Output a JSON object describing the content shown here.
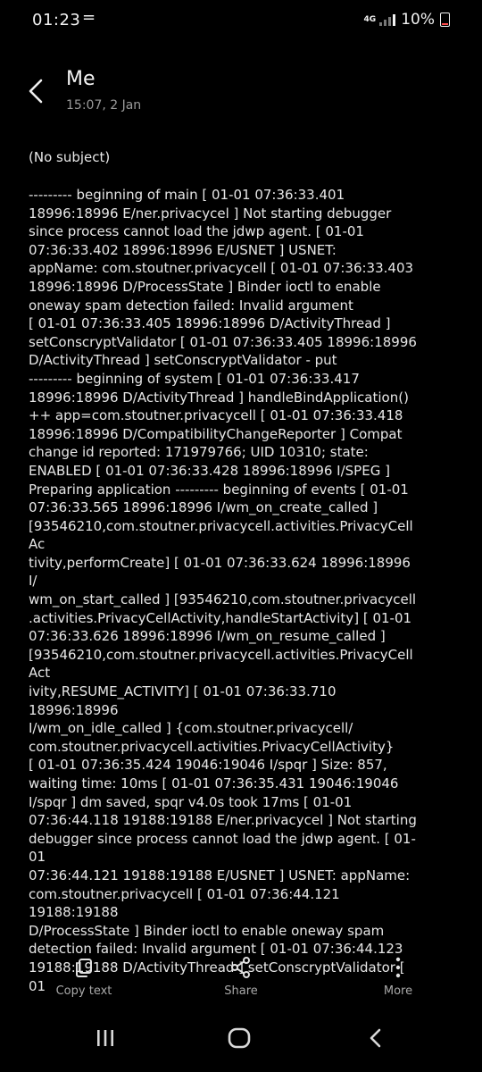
{
  "status_bar": {
    "time": "01:23",
    "menu_glyph": "=",
    "network": "4G",
    "battery": "10%",
    "battery_color": "#ff4a4a"
  },
  "header": {
    "back_icon": "chevron-left-icon",
    "sender": "Me",
    "sent_time": "15:07, 2 Jan"
  },
  "message": {
    "subject": "(No subject)",
    "body": "--------- beginning of main [ 01-01 07:36:33.401\n18996:18996 E/ner.privacycel ] Not starting debugger\nsince process cannot load the jdwp agent.  [ 01-01\n07:36:33.402 18996:18996 E/USNET    ] USNET:\nappName: com.stoutner.privacycell  [ 01-01 07:36:33.403\n18996:18996 D/ProcessState ] Binder ioctl to enable\noneway spam detection failed: Invalid argument\n[ 01-01 07:36:33.405 18996:18996 D/ActivityThread ]\nsetConscryptValidator  [ 01-01 07:36:33.405 18996:18996\nD/ActivityThread ] setConscryptValidator - put\n--------- beginning of system [ 01-01 07:36:33.417\n18996:18996 D/ActivityThread ] handleBindApplication()\n++ app=com.stoutner.privacycell  [ 01-01 07:36:33.418\n18996:18996 D/CompatibilityChangeReporter ] Compat\nchange id reported: 171979766; UID 10310; state:\nENABLED  [ 01-01 07:36:33.428 18996:18996 I/SPEG    ]\nPreparing application  --------- beginning of events [ 01-01\n07:36:33.565 18996:18996 I/wm_on_create_called ]\n[93546210,com.stoutner.privacycell.activities.PrivacyCellAc\ntivity,performCreate]  [ 01-01 07:36:33.624 18996:18996 I/\nwm_on_start_called ] [93546210,com.stoutner.privacycell\n.activities.PrivacyCellActivity,handleStartActivity]  [ 01-01\n07:36:33.626 18996:18996 I/wm_on_resume_called ]\n[93546210,com.stoutner.privacycell.activities.PrivacyCellAct\nivity,RESUME_ACTIVITY]  [ 01-01 07:36:33.710 18996:18996\nI/wm_on_idle_called ] {com.stoutner.privacycell/\ncom.stoutner.privacycell.activities.PrivacyCellActivity}\n[ 01-01 07:36:35.424 19046:19046 I/spqr     ] Size: 857,\nwaiting time: 10ms  [ 01-01 07:36:35.431 19046:19046\nI/spqr     ] dm saved, spqr v4.0s took 17ms  [ 01-01\n07:36:44.118 19188:19188 E/ner.privacycel ] Not starting\ndebugger since process cannot load the jdwp agent.  [ 01-01\n07:36:44.121 19188:19188 E/USNET    ] USNET: appName:\ncom.stoutner.privacycell  [ 01-01 07:36:44.121 19188:19188\nD/ProcessState ] Binder ioctl to enable oneway spam\ndetection failed: Invalid argument  [ 01-01 07:36:44.123\n19188:19188 D/ActivityThread ] setConscryptValidator  [ 01"
  },
  "actions": [
    {
      "label": "Copy text",
      "icon": "copy-icon"
    },
    {
      "label": "Share",
      "icon": "share-icon"
    },
    {
      "label": "More",
      "icon": "more-vertical-icon"
    }
  ],
  "navigation": {
    "recents_icon": "recents-icon",
    "home_icon": "home-icon",
    "back_icon": "back-icon"
  }
}
